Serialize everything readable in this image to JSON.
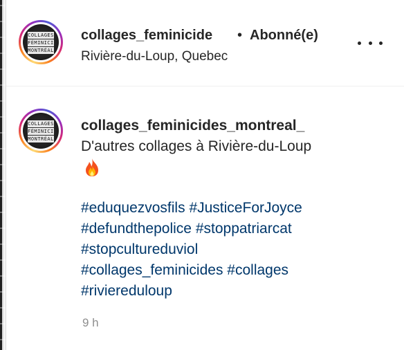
{
  "header": {
    "username": "collages_feminicide",
    "separator": "•",
    "follow_status": "Abonné(e)",
    "location": "Rivière-du-Loup, Quebec",
    "avatar_text": [
      "COLLAGES",
      "FÉMINICIDES",
      "MONTRÉAL"
    ]
  },
  "comment": {
    "username": "collages_feminicides_montreal_",
    "text": "D'autres collages à Rivière-du-Loup",
    "emoji": "fire",
    "hashtag_rows": [
      [
        "#eduquezvosfils",
        "#JusticeForJoyce"
      ],
      [
        "#defundthepolice",
        "#stoppatriarcat"
      ],
      [
        "#stopcultureduviol"
      ],
      [
        "#collages_feminicides",
        "#collages"
      ],
      [
        "#riviereduloup"
      ]
    ],
    "timestamp": "9 h"
  },
  "colors": {
    "text": "#262626",
    "hashtag": "#00376b",
    "muted": "#8e8e8e",
    "divider": "#efefef"
  }
}
